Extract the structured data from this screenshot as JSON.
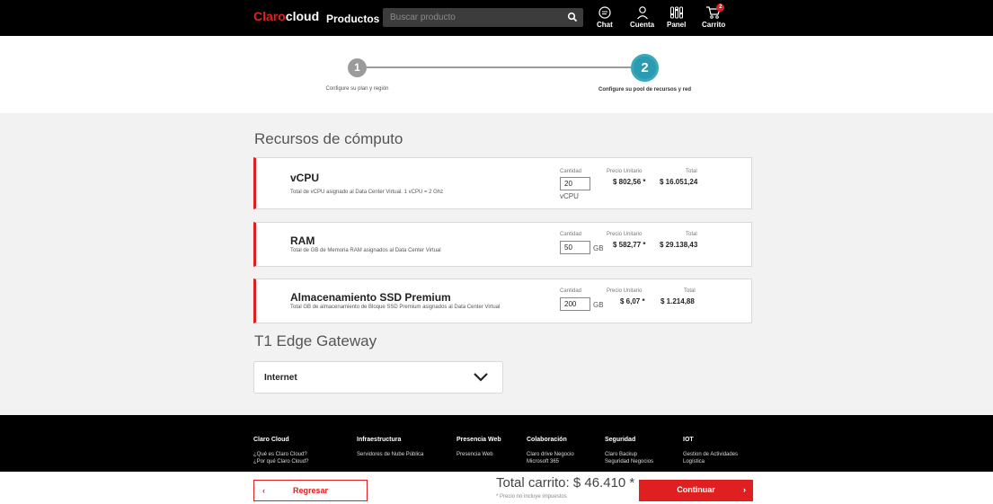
{
  "header": {
    "brand_claro": "Claro",
    "brand_cloud": "cloud",
    "products": "Productos",
    "search_placeholder": "Buscar producto",
    "chat": "Chat",
    "account": "Cuenta",
    "panel": "Panel",
    "cart": "Carrito",
    "cart_count": "2"
  },
  "stepper": {
    "step1_number": "1",
    "step1_label": "Configure su plan y región",
    "step2_number": "2",
    "step2_label": "Configure su pool de recursos y red"
  },
  "compute": {
    "section_title": "Recursos de cómputo",
    "col_quantity": "Cantidad",
    "col_unit_price": "Precio Unitario",
    "col_total": "Total",
    "items": [
      {
        "title": "vCPU",
        "description": "Total de vCPU asignado al Data Center Virtual. 1 vCPU = 2 Ghz",
        "quantity": "20",
        "unit": "vCPU",
        "unit_price": "$ 802,56 *",
        "total": "$ 16.051,24"
      },
      {
        "title": "RAM",
        "description": "Total de GB de Memoria RAM asignados al Data Center Virtual",
        "quantity": "50",
        "unit": "GB",
        "unit_price": "$ 582,77 *",
        "total": "$ 29.138,43"
      },
      {
        "title": "Almacenamiento SSD Premium",
        "description": "Total GB de almacenamiento de Bloque SSD Premium asignados al Data Center Virtual",
        "quantity": "200",
        "unit": "GB",
        "unit_price": "$ 6,07 *",
        "total": "$ 1.214,88"
      }
    ]
  },
  "gateway": {
    "section_title": "T1 Edge Gateway",
    "selected": "Internet"
  },
  "footer": {
    "columns": [
      {
        "title": "Claro Cloud",
        "links": [
          "¿Qué es Claro Cloud?",
          "¿Por qué Claro Cloud?"
        ]
      },
      {
        "title": "Infraestructura",
        "links": [
          "Servidores de Nube Pública"
        ]
      },
      {
        "title": "Presencia Web",
        "links": [
          "Presencia Web"
        ]
      },
      {
        "title": "Colaboración",
        "links": [
          "Claro drive Negocio",
          "Microsoft 365"
        ]
      },
      {
        "title": "Seguridad",
        "links": [
          "Claro Backup",
          "Seguridad Negocios"
        ]
      },
      {
        "title": "IOT",
        "links": [
          "Gestion de Actividades",
          "Logística"
        ]
      }
    ]
  },
  "bottom": {
    "back_arrow": "‹",
    "back_label": "Regresar",
    "total_label": "Total carrito: $ 46.410 *",
    "note": "* Precio no incluye impuestos",
    "next_label": "Continuar",
    "next_arrow": "›"
  },
  "colors": {
    "accent_red": "#e02020",
    "step_active": "#2a9bb0",
    "step_inactive": "#9b9b9b"
  }
}
